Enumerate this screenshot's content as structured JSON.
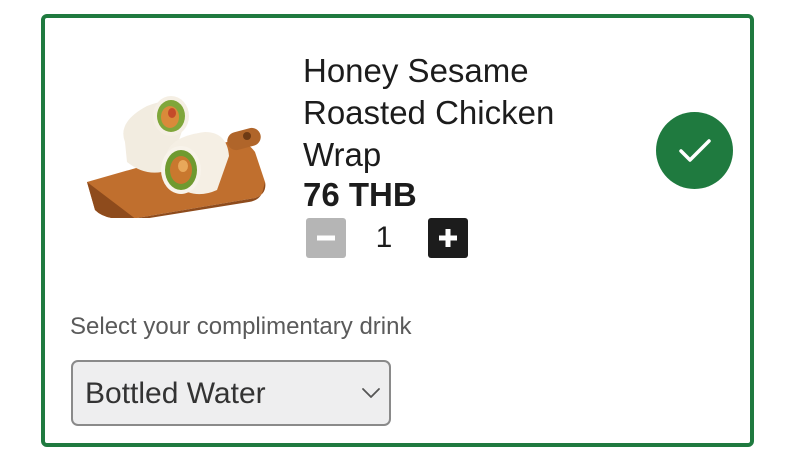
{
  "product": {
    "name": "Honey Sesame Roasted Chicken Wrap",
    "price": "76 THB",
    "image_icon": "chicken-wrap-image",
    "quantity": "1",
    "selected": true
  },
  "quantity_controls": {
    "minus_icon": "minus-icon",
    "plus_icon": "plus-icon"
  },
  "drink": {
    "label": "Select your complimentary drink",
    "selected_value": "Bottled Water",
    "dropdown_icon": "chevron-down-icon"
  },
  "colors": {
    "accent": "#1f7a3f",
    "border": "#1f7a3f",
    "minus_button": "#b5b5b5",
    "plus_button": "#1c1c1c",
    "select_background": "#eeeeef",
    "text": "#1c1c1c",
    "label_text": "#5a5a5a"
  }
}
